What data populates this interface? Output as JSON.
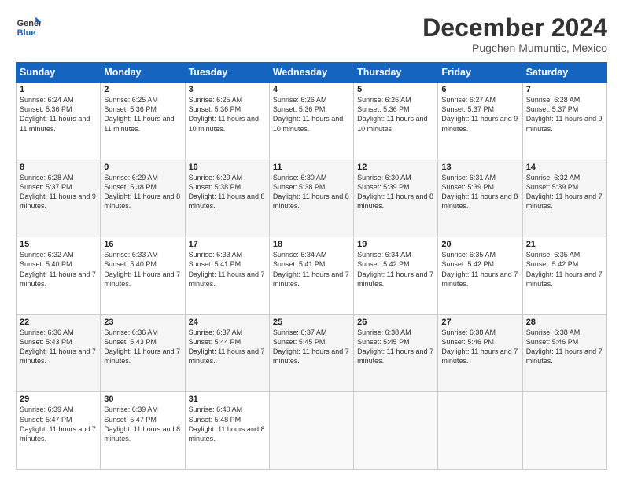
{
  "logo": {
    "line1": "General",
    "line2": "Blue"
  },
  "title": "December 2024",
  "location": "Pugchen Mumuntic, Mexico",
  "days_header": [
    "Sunday",
    "Monday",
    "Tuesday",
    "Wednesday",
    "Thursday",
    "Friday",
    "Saturday"
  ],
  "weeks": [
    [
      {
        "day": "1",
        "sunrise": "6:24 AM",
        "sunset": "5:36 PM",
        "daylight": "11 hours and 11 minutes."
      },
      {
        "day": "2",
        "sunrise": "6:25 AM",
        "sunset": "5:36 PM",
        "daylight": "11 hours and 11 minutes."
      },
      {
        "day": "3",
        "sunrise": "6:25 AM",
        "sunset": "5:36 PM",
        "daylight": "11 hours and 10 minutes."
      },
      {
        "day": "4",
        "sunrise": "6:26 AM",
        "sunset": "5:36 PM",
        "daylight": "11 hours and 10 minutes."
      },
      {
        "day": "5",
        "sunrise": "6:26 AM",
        "sunset": "5:36 PM",
        "daylight": "11 hours and 10 minutes."
      },
      {
        "day": "6",
        "sunrise": "6:27 AM",
        "sunset": "5:37 PM",
        "daylight": "11 hours and 9 minutes."
      },
      {
        "day": "7",
        "sunrise": "6:28 AM",
        "sunset": "5:37 PM",
        "daylight": "11 hours and 9 minutes."
      }
    ],
    [
      {
        "day": "8",
        "sunrise": "6:28 AM",
        "sunset": "5:37 PM",
        "daylight": "11 hours and 9 minutes."
      },
      {
        "day": "9",
        "sunrise": "6:29 AM",
        "sunset": "5:38 PM",
        "daylight": "11 hours and 8 minutes."
      },
      {
        "day": "10",
        "sunrise": "6:29 AM",
        "sunset": "5:38 PM",
        "daylight": "11 hours and 8 minutes."
      },
      {
        "day": "11",
        "sunrise": "6:30 AM",
        "sunset": "5:38 PM",
        "daylight": "11 hours and 8 minutes."
      },
      {
        "day": "12",
        "sunrise": "6:30 AM",
        "sunset": "5:39 PM",
        "daylight": "11 hours and 8 minutes."
      },
      {
        "day": "13",
        "sunrise": "6:31 AM",
        "sunset": "5:39 PM",
        "daylight": "11 hours and 8 minutes."
      },
      {
        "day": "14",
        "sunrise": "6:32 AM",
        "sunset": "5:39 PM",
        "daylight": "11 hours and 7 minutes."
      }
    ],
    [
      {
        "day": "15",
        "sunrise": "6:32 AM",
        "sunset": "5:40 PM",
        "daylight": "11 hours and 7 minutes."
      },
      {
        "day": "16",
        "sunrise": "6:33 AM",
        "sunset": "5:40 PM",
        "daylight": "11 hours and 7 minutes."
      },
      {
        "day": "17",
        "sunrise": "6:33 AM",
        "sunset": "5:41 PM",
        "daylight": "11 hours and 7 minutes."
      },
      {
        "day": "18",
        "sunrise": "6:34 AM",
        "sunset": "5:41 PM",
        "daylight": "11 hours and 7 minutes."
      },
      {
        "day": "19",
        "sunrise": "6:34 AM",
        "sunset": "5:42 PM",
        "daylight": "11 hours and 7 minutes."
      },
      {
        "day": "20",
        "sunrise": "6:35 AM",
        "sunset": "5:42 PM",
        "daylight": "11 hours and 7 minutes."
      },
      {
        "day": "21",
        "sunrise": "6:35 AM",
        "sunset": "5:42 PM",
        "daylight": "11 hours and 7 minutes."
      }
    ],
    [
      {
        "day": "22",
        "sunrise": "6:36 AM",
        "sunset": "5:43 PM",
        "daylight": "11 hours and 7 minutes."
      },
      {
        "day": "23",
        "sunrise": "6:36 AM",
        "sunset": "5:43 PM",
        "daylight": "11 hours and 7 minutes."
      },
      {
        "day": "24",
        "sunrise": "6:37 AM",
        "sunset": "5:44 PM",
        "daylight": "11 hours and 7 minutes."
      },
      {
        "day": "25",
        "sunrise": "6:37 AM",
        "sunset": "5:45 PM",
        "daylight": "11 hours and 7 minutes."
      },
      {
        "day": "26",
        "sunrise": "6:38 AM",
        "sunset": "5:45 PM",
        "daylight": "11 hours and 7 minutes."
      },
      {
        "day": "27",
        "sunrise": "6:38 AM",
        "sunset": "5:46 PM",
        "daylight": "11 hours and 7 minutes."
      },
      {
        "day": "28",
        "sunrise": "6:38 AM",
        "sunset": "5:46 PM",
        "daylight": "11 hours and 7 minutes."
      }
    ],
    [
      {
        "day": "29",
        "sunrise": "6:39 AM",
        "sunset": "5:47 PM",
        "daylight": "11 hours and 7 minutes."
      },
      {
        "day": "30",
        "sunrise": "6:39 AM",
        "sunset": "5:47 PM",
        "daylight": "11 hours and 8 minutes."
      },
      {
        "day": "31",
        "sunrise": "6:40 AM",
        "sunset": "5:48 PM",
        "daylight": "11 hours and 8 minutes."
      },
      null,
      null,
      null,
      null
    ]
  ]
}
